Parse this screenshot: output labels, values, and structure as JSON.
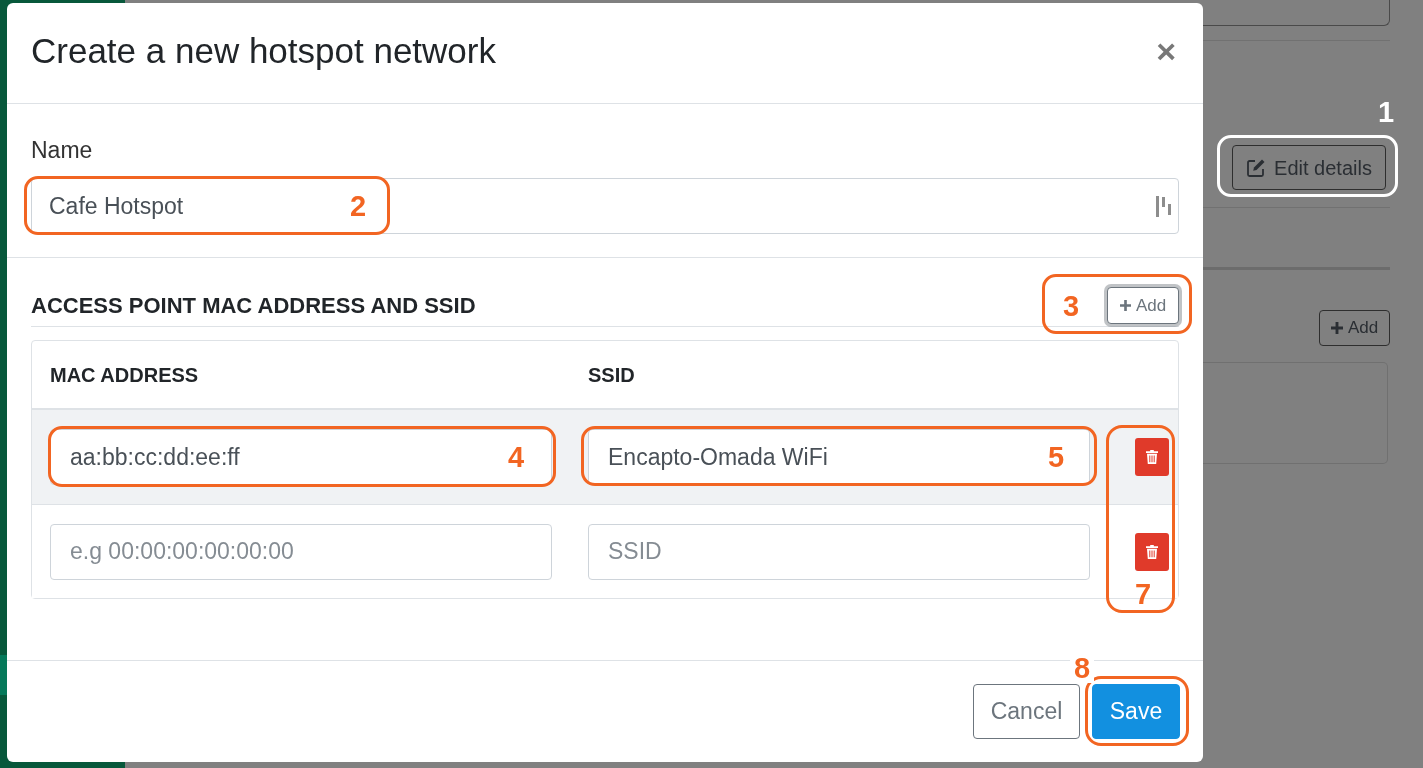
{
  "modal": {
    "title": "Create a new hotspot network",
    "close": "×",
    "name_field": {
      "label": "Name",
      "value": "Cafe Hotspot",
      "callout": {
        "number": "2",
        "color": "#f26522"
      }
    },
    "access_points": {
      "heading": "ACCESS POINT MAC ADDRESS AND SSID",
      "add_button": {
        "label": "Add",
        "callout": {
          "number": "3",
          "color": "#f26522"
        }
      },
      "table": {
        "columns": [
          "MAC ADDRESS",
          "SSID"
        ],
        "rows": [
          {
            "highlighted": true,
            "mac": {
              "value": "aa:bb:cc:dd:ee:ff",
              "callout": {
                "number": "4",
                "color": "#f26522"
              }
            },
            "ssid": {
              "value": "Encapto-Omada WiFi",
              "callout": {
                "number": "5",
                "color": "#f26522"
              }
            }
          },
          {
            "highlighted": false,
            "mac": {
              "placeholder": "e.g 00:00:00:00:00:00"
            },
            "ssid": {
              "placeholder": "SSID"
            }
          }
        ],
        "delete_callout": {
          "number": "7",
          "color": "#f26522"
        }
      }
    },
    "buttons": [
      {
        "label": "Cancel",
        "kind": "secondary"
      },
      {
        "label": "Save",
        "kind": "primary",
        "callout": {
          "number": "8",
          "color": "#f26522"
        }
      }
    ]
  },
  "background_page": {
    "edit_button": {
      "label": "Edit details",
      "callout": {
        "number": "1",
        "color": "#ffffff"
      }
    },
    "add_button": {
      "label": "Add"
    }
  }
}
